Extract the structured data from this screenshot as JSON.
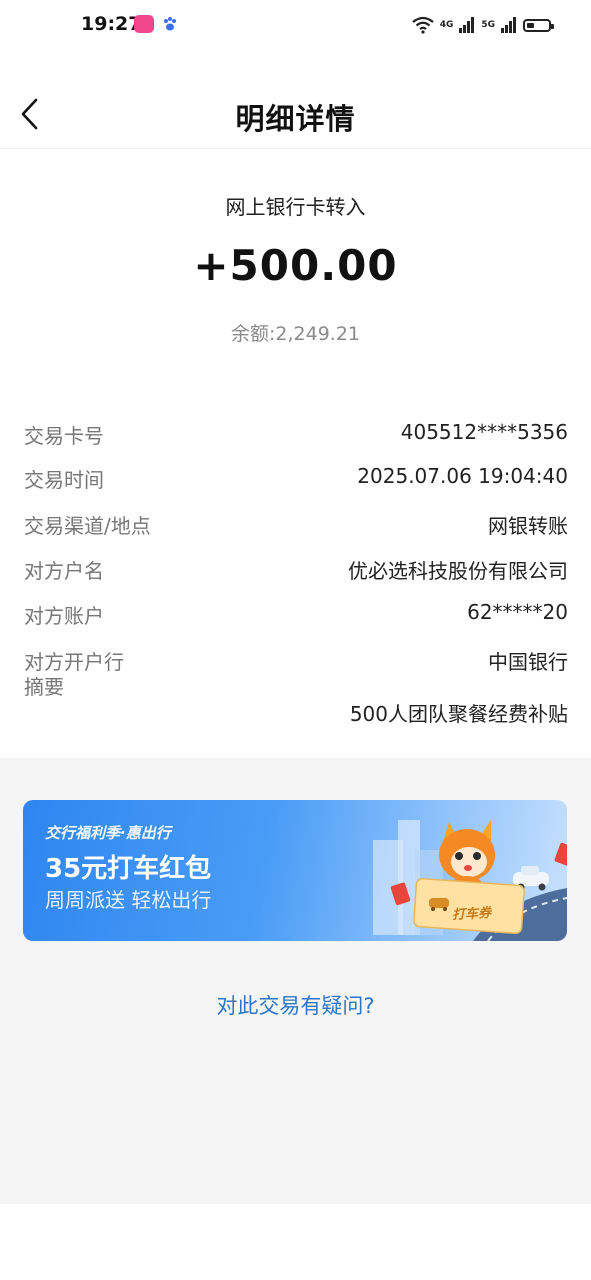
{
  "status_bar": {
    "time": "19:27",
    "network_tags": [
      "4G",
      "5G"
    ],
    "icons": [
      "app-badge-icon",
      "baidu-paw-icon",
      "wifi-icon",
      "signal-icon",
      "battery-icon"
    ]
  },
  "header": {
    "title": "明细详情",
    "back_icon": "chevron-left-icon"
  },
  "summary": {
    "type": "网上银行卡转入",
    "amount": "+500.00",
    "balance": "余额:2,249.21"
  },
  "details": {
    "card_no": {
      "label": "交易卡号",
      "value": "405512****5356"
    },
    "time": {
      "label": "交易时间",
      "value": "2025.07.06 19:04:40"
    },
    "channel": {
      "label": "交易渠道/地点",
      "value": "网银转账"
    },
    "counterparty_name": {
      "label": "对方户名",
      "value": "优必选科技股份有限公司"
    },
    "counterparty_account": {
      "label": "对方账户",
      "value": "62*****20"
    },
    "counterparty_bank": {
      "label": "对方开户行",
      "value": "中国银行"
    },
    "memo": {
      "label": "摘要",
      "value": "500人团队聚餐经费补贴"
    }
  },
  "banner": {
    "brand": "交行福利季·惠出行",
    "title": "35元打车红包",
    "subtitle": "周周派送 轻松出行",
    "coupon_label": "打车券",
    "colors": {
      "start": "#2f86ef",
      "end": "#c9e2fd"
    }
  },
  "question_link": "对此交易有疑问?",
  "colors": {
    "link": "#2c77c9",
    "label": "#777777",
    "value": "#222222"
  }
}
